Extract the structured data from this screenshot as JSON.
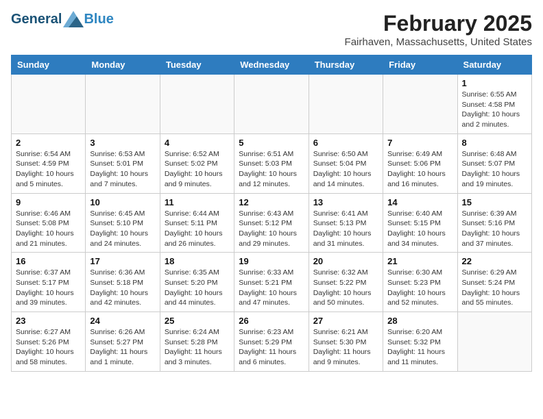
{
  "header": {
    "logo_general": "General",
    "logo_blue": "Blue",
    "month_title": "February 2025",
    "location": "Fairhaven, Massachusetts, United States"
  },
  "weekdays": [
    "Sunday",
    "Monday",
    "Tuesday",
    "Wednesday",
    "Thursday",
    "Friday",
    "Saturday"
  ],
  "weeks": [
    [
      {
        "day": "",
        "info": ""
      },
      {
        "day": "",
        "info": ""
      },
      {
        "day": "",
        "info": ""
      },
      {
        "day": "",
        "info": ""
      },
      {
        "day": "",
        "info": ""
      },
      {
        "day": "",
        "info": ""
      },
      {
        "day": "1",
        "info": "Sunrise: 6:55 AM\nSunset: 4:58 PM\nDaylight: 10 hours and 2 minutes."
      }
    ],
    [
      {
        "day": "2",
        "info": "Sunrise: 6:54 AM\nSunset: 4:59 PM\nDaylight: 10 hours and 5 minutes."
      },
      {
        "day": "3",
        "info": "Sunrise: 6:53 AM\nSunset: 5:01 PM\nDaylight: 10 hours and 7 minutes."
      },
      {
        "day": "4",
        "info": "Sunrise: 6:52 AM\nSunset: 5:02 PM\nDaylight: 10 hours and 9 minutes."
      },
      {
        "day": "5",
        "info": "Sunrise: 6:51 AM\nSunset: 5:03 PM\nDaylight: 10 hours and 12 minutes."
      },
      {
        "day": "6",
        "info": "Sunrise: 6:50 AM\nSunset: 5:04 PM\nDaylight: 10 hours and 14 minutes."
      },
      {
        "day": "7",
        "info": "Sunrise: 6:49 AM\nSunset: 5:06 PM\nDaylight: 10 hours and 16 minutes."
      },
      {
        "day": "8",
        "info": "Sunrise: 6:48 AM\nSunset: 5:07 PM\nDaylight: 10 hours and 19 minutes."
      }
    ],
    [
      {
        "day": "9",
        "info": "Sunrise: 6:46 AM\nSunset: 5:08 PM\nDaylight: 10 hours and 21 minutes."
      },
      {
        "day": "10",
        "info": "Sunrise: 6:45 AM\nSunset: 5:10 PM\nDaylight: 10 hours and 24 minutes."
      },
      {
        "day": "11",
        "info": "Sunrise: 6:44 AM\nSunset: 5:11 PM\nDaylight: 10 hours and 26 minutes."
      },
      {
        "day": "12",
        "info": "Sunrise: 6:43 AM\nSunset: 5:12 PM\nDaylight: 10 hours and 29 minutes."
      },
      {
        "day": "13",
        "info": "Sunrise: 6:41 AM\nSunset: 5:13 PM\nDaylight: 10 hours and 31 minutes."
      },
      {
        "day": "14",
        "info": "Sunrise: 6:40 AM\nSunset: 5:15 PM\nDaylight: 10 hours and 34 minutes."
      },
      {
        "day": "15",
        "info": "Sunrise: 6:39 AM\nSunset: 5:16 PM\nDaylight: 10 hours and 37 minutes."
      }
    ],
    [
      {
        "day": "16",
        "info": "Sunrise: 6:37 AM\nSunset: 5:17 PM\nDaylight: 10 hours and 39 minutes."
      },
      {
        "day": "17",
        "info": "Sunrise: 6:36 AM\nSunset: 5:18 PM\nDaylight: 10 hours and 42 minutes."
      },
      {
        "day": "18",
        "info": "Sunrise: 6:35 AM\nSunset: 5:20 PM\nDaylight: 10 hours and 44 minutes."
      },
      {
        "day": "19",
        "info": "Sunrise: 6:33 AM\nSunset: 5:21 PM\nDaylight: 10 hours and 47 minutes."
      },
      {
        "day": "20",
        "info": "Sunrise: 6:32 AM\nSunset: 5:22 PM\nDaylight: 10 hours and 50 minutes."
      },
      {
        "day": "21",
        "info": "Sunrise: 6:30 AM\nSunset: 5:23 PM\nDaylight: 10 hours and 52 minutes."
      },
      {
        "day": "22",
        "info": "Sunrise: 6:29 AM\nSunset: 5:24 PM\nDaylight: 10 hours and 55 minutes."
      }
    ],
    [
      {
        "day": "23",
        "info": "Sunrise: 6:27 AM\nSunset: 5:26 PM\nDaylight: 10 hours and 58 minutes."
      },
      {
        "day": "24",
        "info": "Sunrise: 6:26 AM\nSunset: 5:27 PM\nDaylight: 11 hours and 1 minute."
      },
      {
        "day": "25",
        "info": "Sunrise: 6:24 AM\nSunset: 5:28 PM\nDaylight: 11 hours and 3 minutes."
      },
      {
        "day": "26",
        "info": "Sunrise: 6:23 AM\nSunset: 5:29 PM\nDaylight: 11 hours and 6 minutes."
      },
      {
        "day": "27",
        "info": "Sunrise: 6:21 AM\nSunset: 5:30 PM\nDaylight: 11 hours and 9 minutes."
      },
      {
        "day": "28",
        "info": "Sunrise: 6:20 AM\nSunset: 5:32 PM\nDaylight: 11 hours and 11 minutes."
      },
      {
        "day": "",
        "info": ""
      }
    ]
  ]
}
